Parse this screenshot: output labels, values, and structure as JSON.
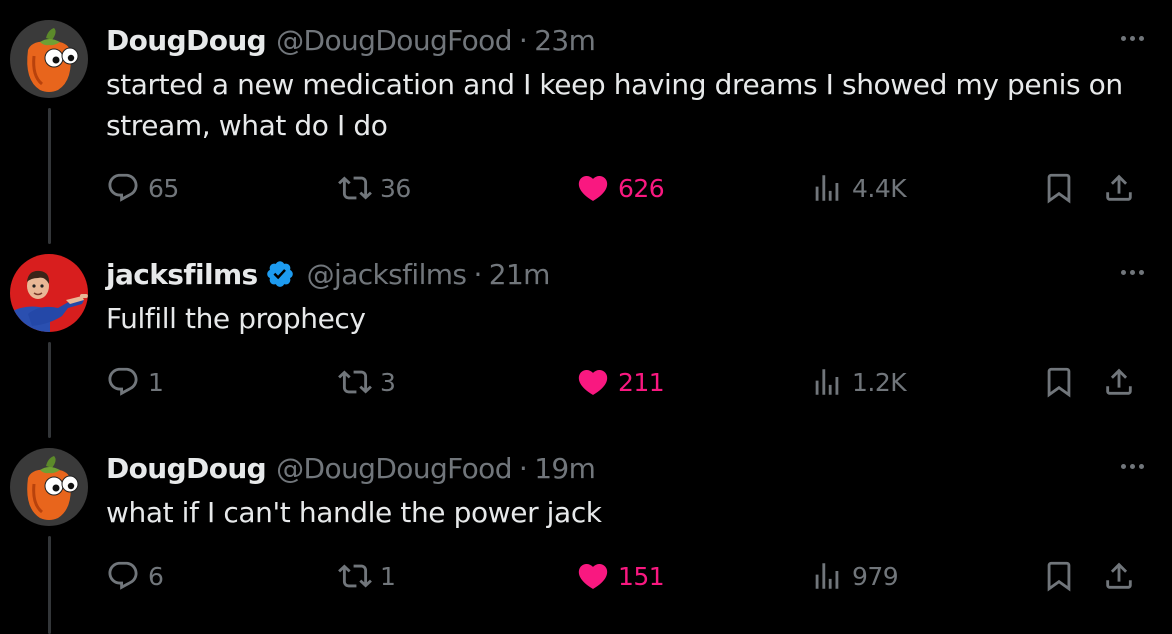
{
  "colors": {
    "background": "#000000",
    "text": "#e7e9ea",
    "muted": "#71767b",
    "like": "#f91880",
    "verified": "#1d9bf0",
    "thread_line": "#333639"
  },
  "tweets": [
    {
      "avatar": "orange-pepper-with-googly-eyes",
      "display_name": "DougDoug",
      "verified": false,
      "handle": "@DougDougFood",
      "separator": "·",
      "time": "23m",
      "text": "started a new medication and I keep having dreams I showed my penis on stream, what do I do",
      "replies": "65",
      "reposts": "36",
      "likes": "626",
      "views": "4.4K",
      "liked": true
    },
    {
      "avatar": "man-pointing-red-background",
      "display_name": "jacksfilms",
      "verified": true,
      "handle": "@jacksfilms",
      "separator": "·",
      "time": "21m",
      "text": "Fulfill the prophecy",
      "replies": "1",
      "reposts": "3",
      "likes": "211",
      "views": "1.2K",
      "liked": true
    },
    {
      "avatar": "orange-pepper-with-googly-eyes",
      "display_name": "DougDoug",
      "verified": false,
      "handle": "@DougDougFood",
      "separator": "·",
      "time": "19m",
      "text": "what if I can't handle the power jack",
      "replies": "6",
      "reposts": "1",
      "likes": "151",
      "views": "979",
      "liked": true
    }
  ],
  "icons": {
    "reply": "reply-icon",
    "repost": "repost-icon",
    "like": "heart-icon",
    "views": "views-icon",
    "bookmark": "bookmark-icon",
    "share": "share-icon",
    "more": "more-icon",
    "verified": "verified-badge-icon"
  }
}
